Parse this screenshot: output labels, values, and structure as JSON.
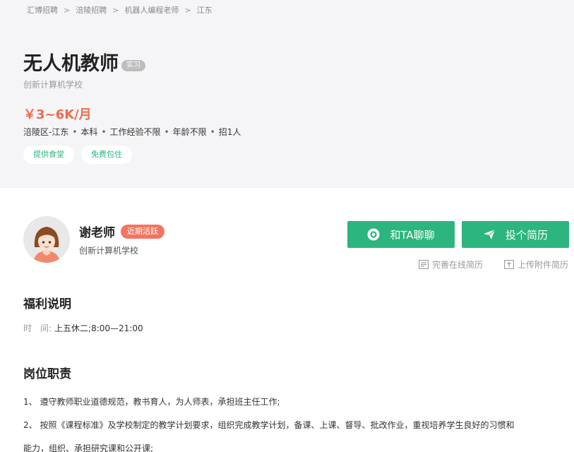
{
  "breadcrumb": [
    "汇博招聘",
    "涪陵招聘",
    "机器人编程老师",
    "江东"
  ],
  "job": {
    "title": "无人机教师",
    "tag": "实习",
    "company": "创新计算机学校",
    "salary": "￥3~6K/月",
    "meta": [
      "涪陵区-江东",
      "本科",
      "工作经验不限",
      "年龄不限",
      "招1人"
    ],
    "benefits": [
      "提供食堂",
      "免费包住"
    ]
  },
  "recruiter": {
    "name": "谢老师",
    "badge": "近期活跃",
    "company": "创新计算机学校"
  },
  "actions": {
    "chat_label": "和TA聊聊",
    "apply_label": "投个简历",
    "online_resume": "完善在线简历",
    "upload_resume": "上传附件简历"
  },
  "welfare": {
    "title": "福利说明",
    "time_label": "时　间:",
    "time_value": "上五休二;8:00—21:00"
  },
  "duties": {
    "title": "岗位职责",
    "lines": [
      "1、 遵守教师职业道德规范，教书育人，为人师表，承担班主任工作;",
      "2、 按照《课程标准》及学校制定的教学计划要求，组织完成教学计划，备课、上课、督导、批改作业，重视培养学生良好的习惯和",
      "能力，组织、承担研究课和公开课;"
    ]
  },
  "colors": {
    "accent": "#2cb57e",
    "salary": "#f26a4b",
    "badge": "#f27561"
  }
}
